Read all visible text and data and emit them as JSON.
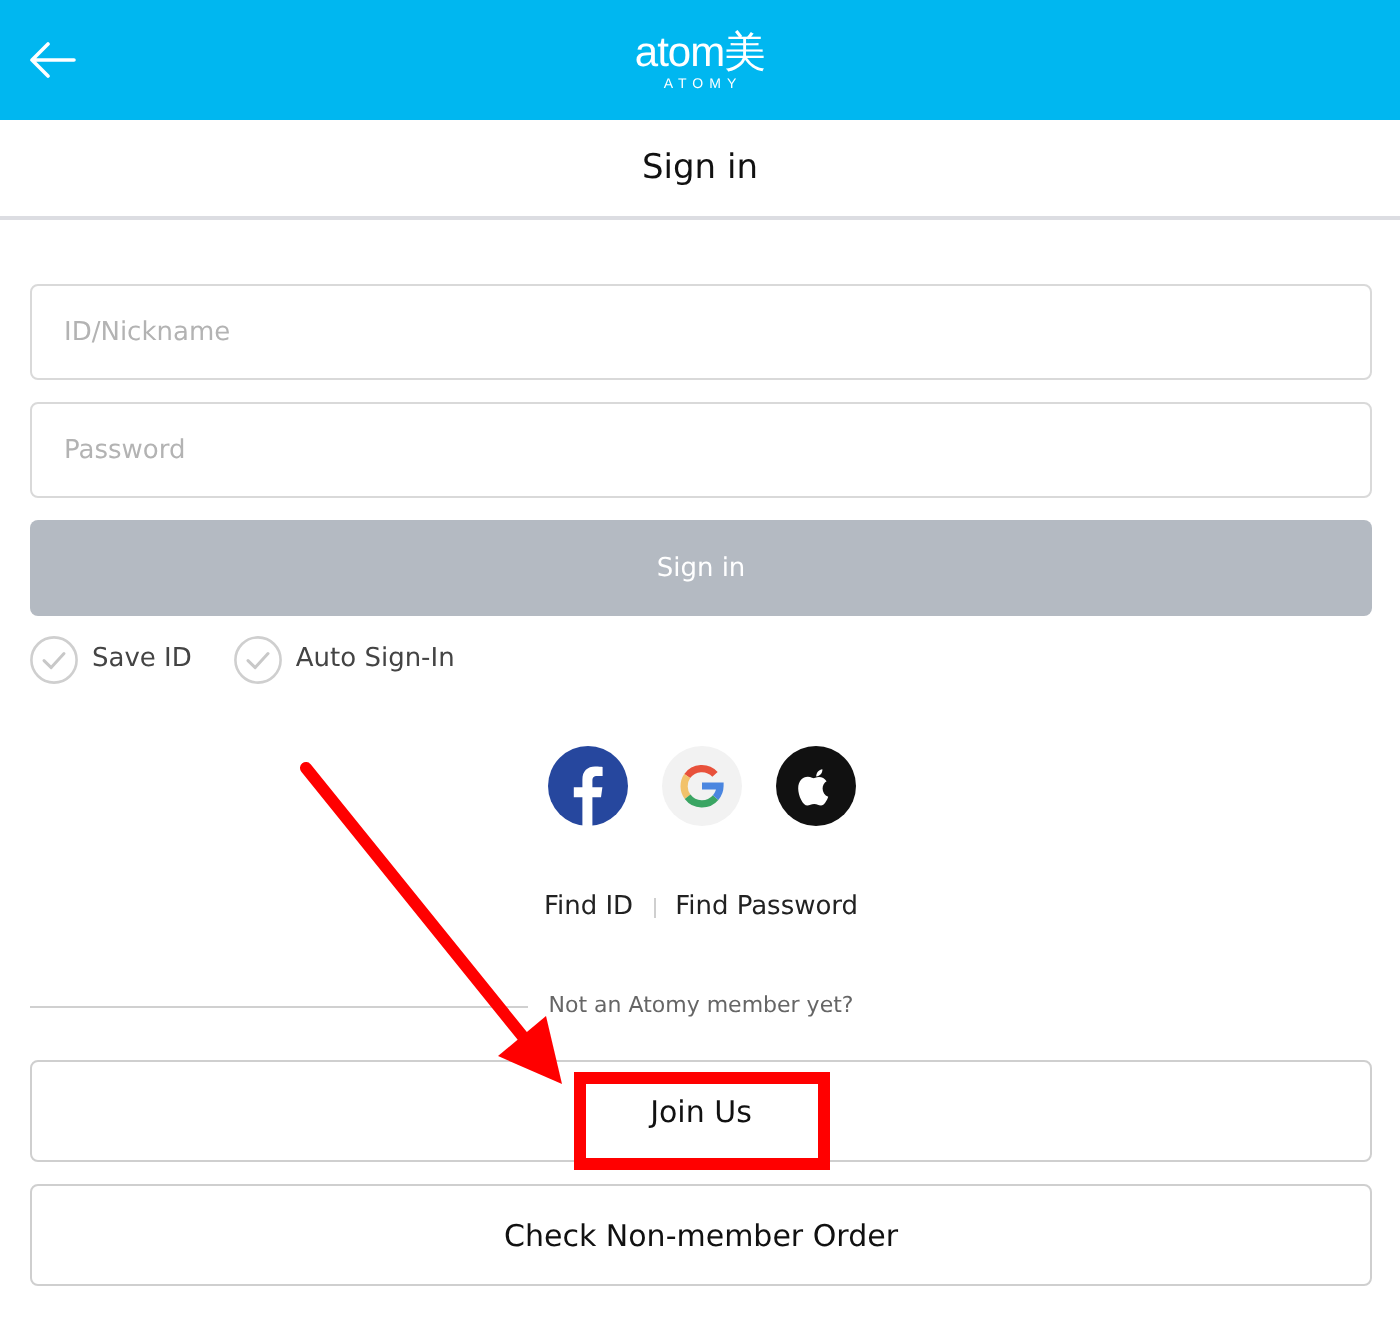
{
  "header": {
    "logo_text": "atom美",
    "logo_subtext": "ATOMY"
  },
  "page_title": "Sign in",
  "fields": [
    {
      "placeholder": "ID/Nickname"
    },
    {
      "placeholder": "Password"
    }
  ],
  "sign_in_button": {
    "label": "Sign in",
    "disabled": true
  },
  "options": [
    {
      "label": "Save ID",
      "checked": false
    },
    {
      "label": "Auto Sign-In",
      "checked": false
    }
  ],
  "social_logins": [
    {
      "kind": "facebook"
    },
    {
      "kind": "google"
    },
    {
      "kind": "apple"
    }
  ],
  "links": [
    {
      "label": "Find ID"
    },
    {
      "label": "Find Password"
    }
  ],
  "member_section": {
    "prompt": "Not an Atomy member yet?",
    "buttons": [
      {
        "label": "Join Us",
        "highlighted": true
      },
      {
        "label": "Check Non-member Order",
        "highlighted": false
      }
    ]
  },
  "annotations": [
    {
      "kind": "arrow"
    }
  ]
}
